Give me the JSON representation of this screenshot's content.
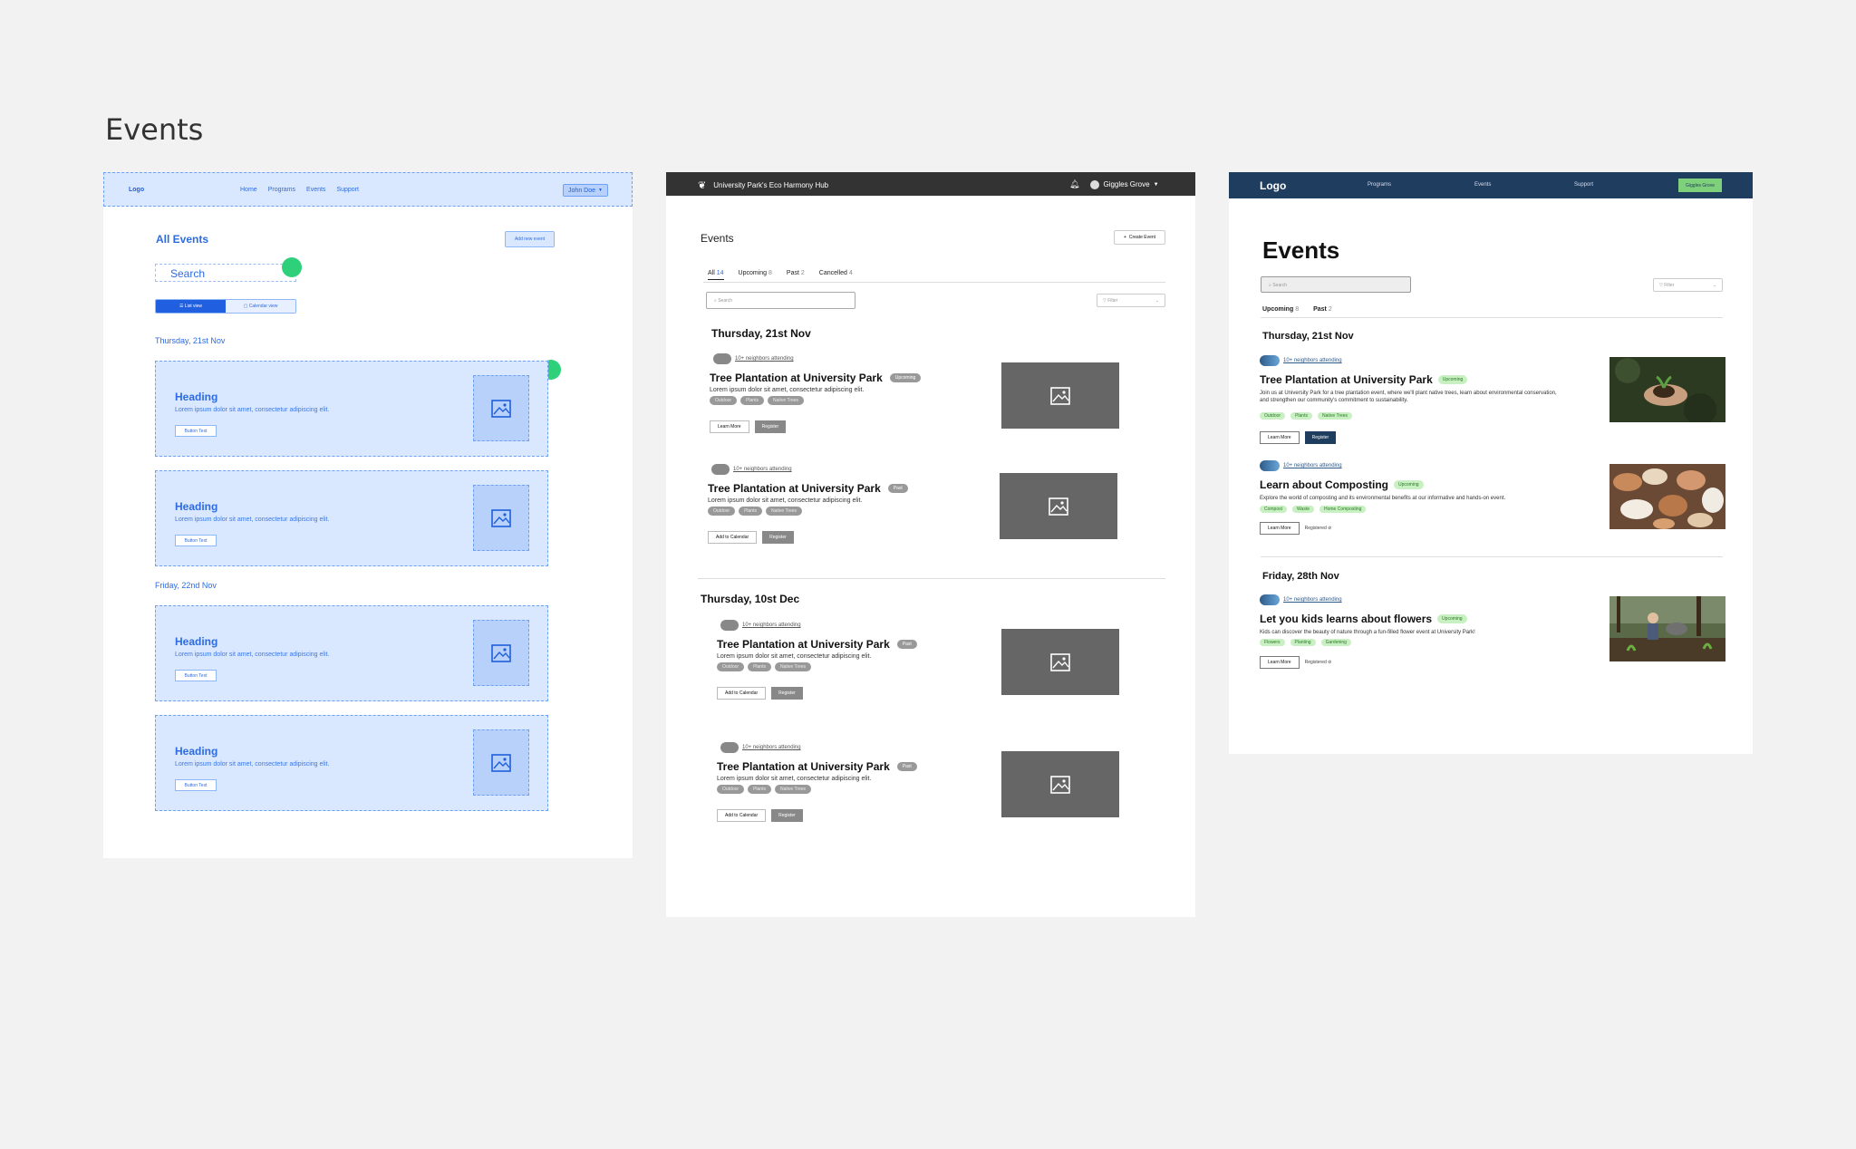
{
  "page_title": "Events",
  "frame1": {
    "nav": {
      "logo": "Logo",
      "links": [
        "Home",
        "Programs",
        "Events",
        "Support"
      ],
      "user": "John Doe"
    },
    "heading": "All Events",
    "add_button": "Add new event",
    "search_placeholder": "Search",
    "toggle": {
      "list": "List view",
      "calendar": "Calendar view"
    },
    "dates": [
      "Thursday, 21st Nov",
      "Friday, 22nd Nov"
    ],
    "cards": [
      {
        "heading": "Heading",
        "text": "Lorem ipsum dolor sit amet, consectetur adipiscing elit.",
        "button": "Button Text"
      },
      {
        "heading": "Heading",
        "text": "Lorem ipsum dolor sit amet, consectetur adipiscing elit.",
        "button": "Button Text"
      },
      {
        "heading": "Heading",
        "text": "Lorem ipsum dolor sit amet, consectetur adipiscing elit.",
        "button": "Button Text"
      },
      {
        "heading": "Heading",
        "text": "Lorem ipsum dolor sit amet, consectetur adipiscing elit.",
        "button": "Button Text"
      }
    ]
  },
  "frame2": {
    "nav": {
      "brand": "University Park's Eco Harmony Hub",
      "user": "Giggles Grove"
    },
    "heading": "Events",
    "create_button": "Create Event",
    "tabs": [
      {
        "label": "All",
        "count": "14"
      },
      {
        "label": "Upcoming",
        "count": "8"
      },
      {
        "label": "Past",
        "count": "2"
      },
      {
        "label": "Cancelled",
        "count": "4"
      }
    ],
    "search_placeholder": "Search",
    "filter_placeholder": "Filter",
    "dates": [
      "Thursday, 21st Nov",
      "Thursday, 10st Dec"
    ],
    "events": [
      {
        "attending": "10+ neighbors attending",
        "title": "Tree Plantation at University Park",
        "badge": "Upcoming",
        "desc": "Lorem ipsum dolor sit amet, consectetur adipiscing elit.",
        "tags": [
          "Outdoor",
          "Plants",
          "Native Trees"
        ],
        "btn1": "Learn More",
        "btn2": "Register"
      },
      {
        "attending": "10+ neighbors attending",
        "title": "Tree Plantation at University Park",
        "badge": "Past",
        "desc": "Lorem ipsum dolor sit amet, consectetur adipiscing elit.",
        "tags": [
          "Outdoor",
          "Plants",
          "Native Trees"
        ],
        "btn1": "Add to Calendar",
        "btn2": "Register"
      },
      {
        "attending": "10+ neighbors attending",
        "title": "Tree Plantation at University Park",
        "badge": "Past",
        "desc": "Lorem ipsum dolor sit amet, consectetur adipiscing elit.",
        "tags": [
          "Outdoor",
          "Plants",
          "Native Trees"
        ],
        "btn1": "Add to Calendar",
        "btn2": "Register"
      },
      {
        "attending": "10+ neighbors attending",
        "title": "Tree Plantation at University Park",
        "badge": "Past",
        "desc": "Lorem ipsum dolor sit amet, consectetur adipiscing elit.",
        "tags": [
          "Outdoor",
          "Plants",
          "Native Trees"
        ],
        "btn1": "Add to Calendar",
        "btn2": "Register"
      }
    ]
  },
  "frame3": {
    "nav": {
      "logo": "Logo",
      "links": [
        "Programs",
        "Events",
        "Support"
      ],
      "user": "Giggles Grove"
    },
    "heading": "Events",
    "search_placeholder": "Search",
    "filter_placeholder": "Filter",
    "tabs": [
      {
        "label": "Upcoming",
        "count": "8"
      },
      {
        "label": "Past",
        "count": "2"
      }
    ],
    "dates": [
      "Thursday, 21st Nov",
      "Friday, 28th Nov"
    ],
    "events": [
      {
        "attending": "10+ neighbors attending",
        "title": "Tree Plantation at University Park",
        "badge": "Upcoming",
        "desc": "Join us at University Park for a tree plantation event, where we'll plant native trees, learn about environmental conservation, and strengthen our community's commitment to sustainability.",
        "tags": [
          "Outdoor",
          "Plants",
          "Native Trees"
        ],
        "btn1": "Learn More",
        "btn2": "Register",
        "registered": ""
      },
      {
        "attending": "10+ neighbors attending",
        "title": "Learn about Composting",
        "badge": "Upcoming",
        "desc": "Explore the world of composting and its environmental benefits at our informative and hands-on event.",
        "tags": [
          "Compost",
          "Waste",
          "Home Composting"
        ],
        "btn1": "Learn More",
        "btn2": "",
        "registered": "Registered"
      },
      {
        "attending": "10+ neighbors attending",
        "title": "Let you kids learns about flowers",
        "badge": "Upcoming",
        "desc": "Kids can discover the beauty of nature through a fun-filled flower event at University Park!",
        "tags": [
          "Flowers",
          "Planting",
          "Gardening"
        ],
        "btn1": "Learn More",
        "btn2": "",
        "registered": "Registered"
      }
    ]
  },
  "colors": {
    "wire_blue": "#2d6be0",
    "navy": "#1e3d5f",
    "green_badge": "#c9f0c2",
    "dot_green": "#2fd07a"
  }
}
